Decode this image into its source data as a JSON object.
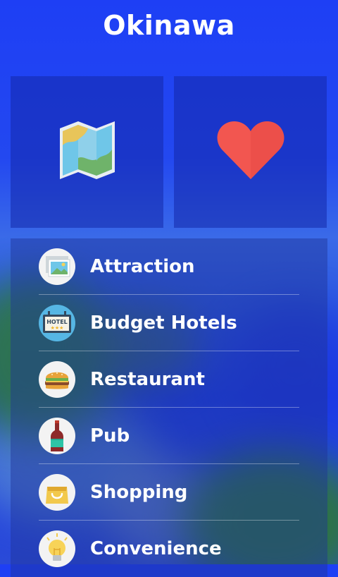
{
  "header": {
    "title": "Okinawa"
  },
  "tiles": [
    {
      "icon": "map-icon"
    },
    {
      "icon": "heart-icon",
      "color": "#f25650"
    }
  ],
  "menu": {
    "items": [
      {
        "label": "Attraction",
        "icon": "photo-icon"
      },
      {
        "label": "Budget Hotels",
        "icon": "hotel-sign-icon",
        "sign": "HOTEL"
      },
      {
        "label": "Restaurant",
        "icon": "burger-icon"
      },
      {
        "label": "Pub",
        "icon": "bottle-icon"
      },
      {
        "label": "Shopping",
        "icon": "shopping-bag-icon"
      },
      {
        "label": "Convenience",
        "icon": "light-bulb-icon"
      }
    ]
  },
  "colors": {
    "header_bg": "#1e3ff5",
    "text": "#ffffff",
    "heart": "#f25650"
  }
}
